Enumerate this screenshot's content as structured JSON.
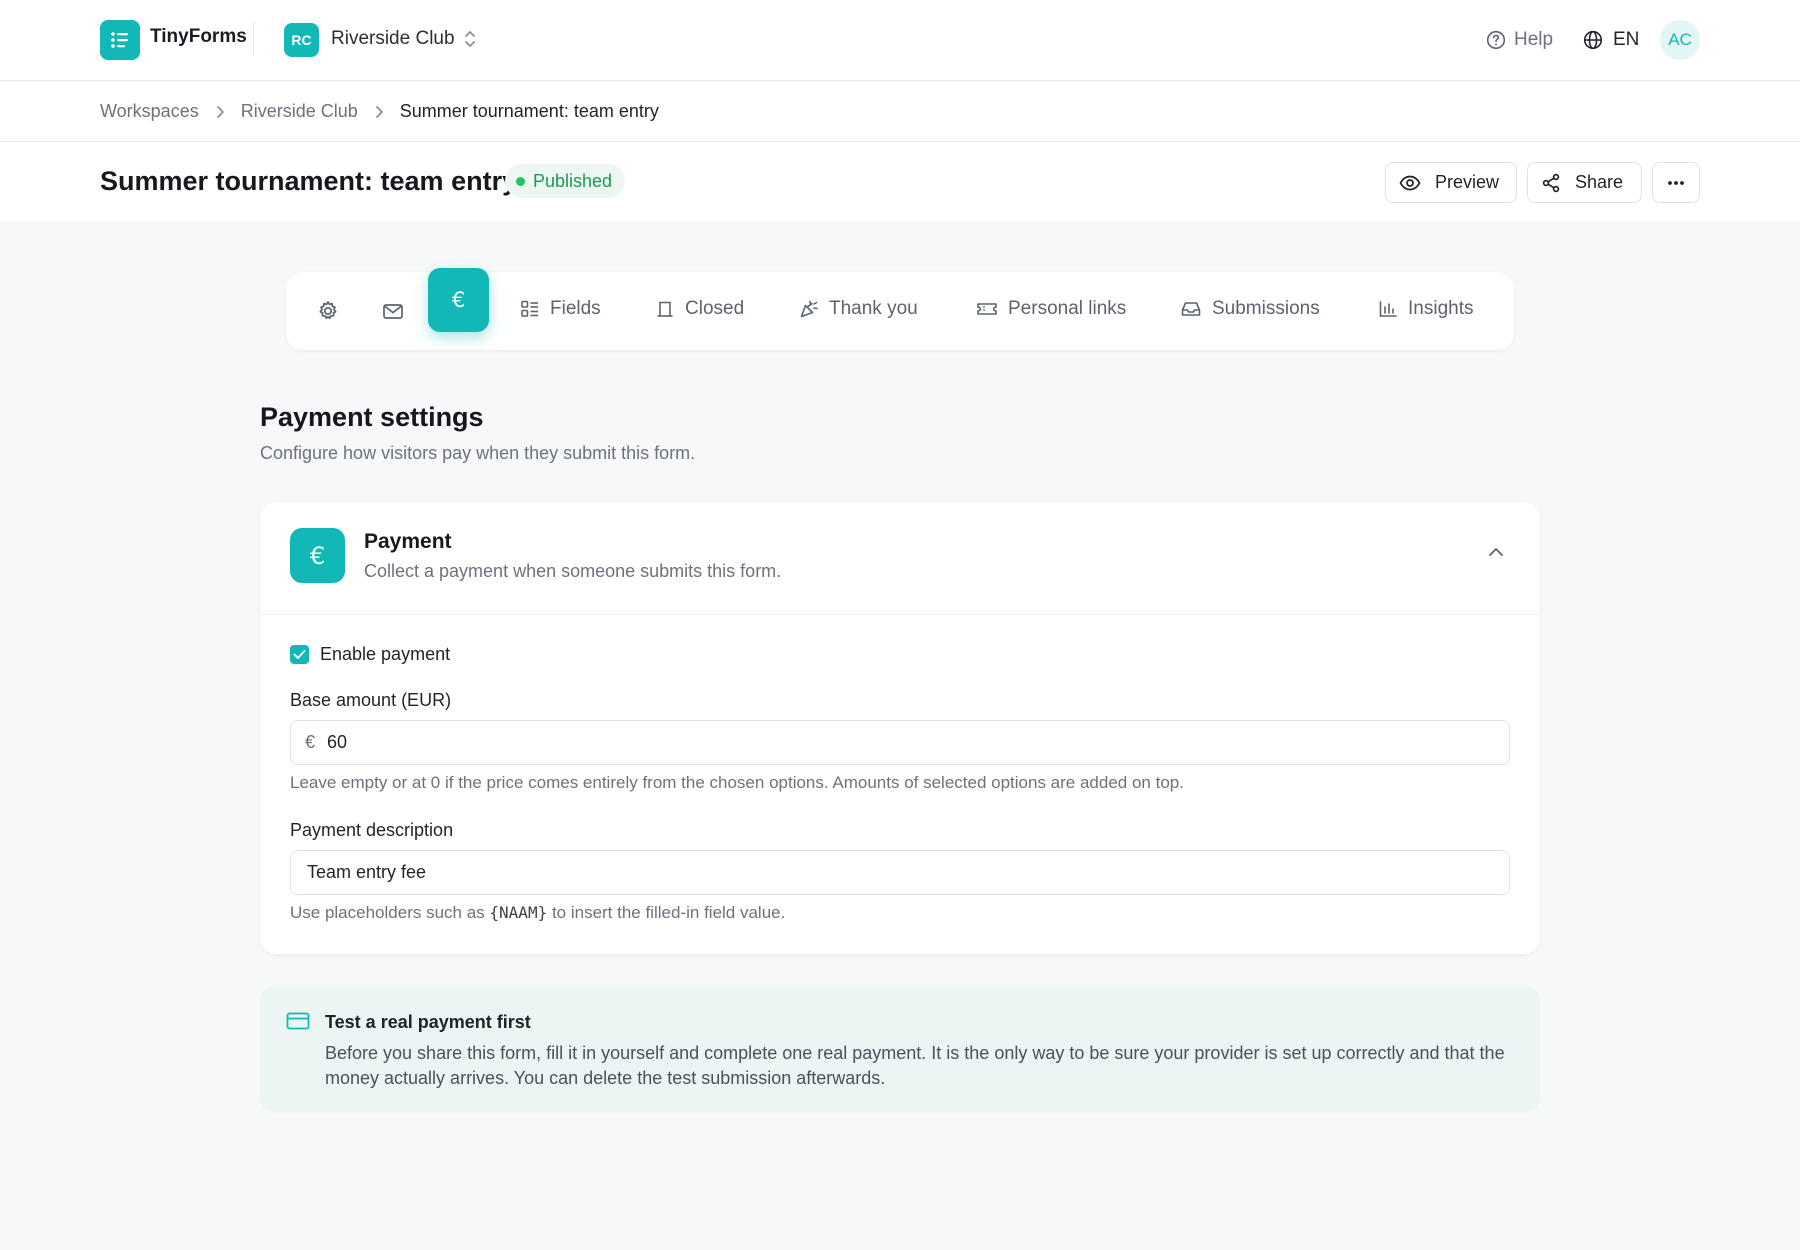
{
  "app": {
    "brand_name": "TinyForms",
    "brand_color": "#12b8b5"
  },
  "workspace": {
    "initials": "RC",
    "name": "Riverside Club"
  },
  "header": {
    "help_label": "Help",
    "language": "EN",
    "user_initials": "AC"
  },
  "breadcrumb": [
    "Workspaces",
    "Riverside Club",
    "Summer tournament: team entry"
  ],
  "page": {
    "title": "Summer tournament: team entry",
    "status": "Published",
    "actions": {
      "preview_label": "Preview",
      "share_label": "Share",
      "more_icon": "more-horizontal-icon"
    }
  },
  "tabs": {
    "icon_only": [
      "settings-gear-icon",
      "mail-icon",
      "euro-icon"
    ],
    "active": "euro-icon",
    "labeled": [
      {
        "label": "Fields",
        "icon": "fields-list-icon"
      },
      {
        "label": "Closed",
        "icon": "closed-door-icon"
      },
      {
        "label": "Thank you",
        "icon": "party-popper-icon"
      },
      {
        "label": "Personal links",
        "icon": "ticket-icon"
      },
      {
        "label": "Submissions",
        "icon": "inbox-icon"
      },
      {
        "label": "Insights",
        "icon": "bar-chart-icon"
      }
    ]
  },
  "section": {
    "title": "Payment settings",
    "subtitle": "Configure how visitors pay when they submit this form."
  },
  "payment_card": {
    "title": "Payment",
    "description": "Collect a payment when someone submits this form.",
    "enable_label": "Enable payment",
    "enabled": true,
    "base_amount": {
      "label": "Base amount (EUR)",
      "prefix": "€",
      "value": "60",
      "hint": "Leave empty or at 0 if the price comes entirely from the chosen options. Amounts of selected options are added on top."
    },
    "payment_description": {
      "label": "Payment description",
      "value": "Team entry fee",
      "hint_before": "Use placeholders such as",
      "hint_code": "{NAAM}",
      "hint_after": "to insert the filled-in field value."
    }
  },
  "callout": {
    "title": "Test a real payment first",
    "body": "Before you share this form, fill it in yourself and complete one real payment. It is the only way to be sure your provider is set up correctly and that the money actually arrives. You can delete the test submission afterwards."
  }
}
